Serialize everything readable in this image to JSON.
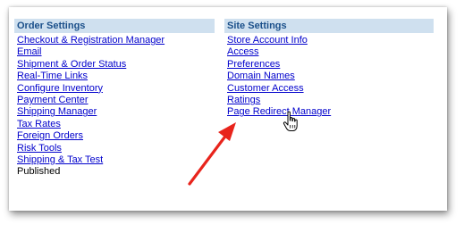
{
  "order_settings": {
    "title": "Order Settings",
    "links": [
      "Checkout & Registration Manager",
      "Email",
      "Shipment & Order Status",
      "Real-Time Links",
      "Configure Inventory",
      "Payment Center",
      "Shipping Manager",
      "Tax Rates",
      "Foreign Orders",
      "Risk Tools",
      "Shipping & Tax Test"
    ],
    "status_text": "Published"
  },
  "site_settings": {
    "title": "Site Settings",
    "links": [
      "Store Account Info",
      "Access",
      "Preferences",
      "Domain Names",
      "Customer Access",
      "Ratings",
      "Page Redirect Manager"
    ]
  },
  "colors": {
    "header_bg": "#cfe0ef",
    "header_text": "#1a4f8a",
    "link": "#0000cc",
    "annotation_arrow": "#e8241c"
  },
  "icons": {
    "cursor": "hand-pointer-icon",
    "annotation": "red-arrow-icon"
  }
}
